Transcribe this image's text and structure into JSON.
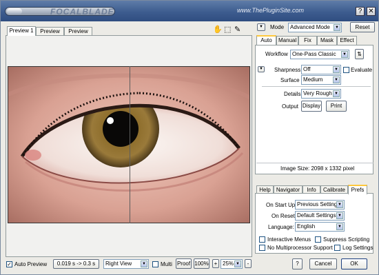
{
  "titlebar": {
    "logo_text": "FOCALBLADE",
    "site": "www.ThePluginSite.com",
    "help_btn": "?",
    "close_btn": "✕"
  },
  "preview_tabs": [
    "Preview 1",
    "Preview 2",
    "Preview 3"
  ],
  "tools": {
    "hand": "✋",
    "marquee": "⬚",
    "picker": "✎"
  },
  "mode": {
    "label": "Mode",
    "value": "Advanced Mode",
    "reset": "Reset",
    "collapse": "▼"
  },
  "main_tabs": [
    "Auto",
    "Manual",
    "Fix",
    "Mask",
    "Effect"
  ],
  "auto": {
    "workflow_label": "Workflow",
    "workflow_value": "One-Pass Classic",
    "workflow_btn": "⇅",
    "sharpness_label": "Sharpness",
    "sharpness_value": "Off",
    "evaluate_label": "Evaluate",
    "surface_label": "Surface",
    "surface_value": "Medium",
    "details_label": "Details",
    "details_value": "Very Rough",
    "output_label": "Output",
    "display_btn": "Display",
    "print_btn": "Print",
    "image_size": "Image Size:  2098 x 1332 pixel"
  },
  "pref_tabs": [
    "Help",
    "Navigator",
    "Info",
    "Calibrate",
    "Prefs"
  ],
  "prefs": {
    "startup_label": "On Start Up",
    "startup_value": "Previous Settings",
    "reset_label": "On Reset",
    "reset_value": "Default Settings",
    "language_label": "Language:",
    "language_value": "English",
    "interactive_menus": "Interactive Menus",
    "suppress_scripting": "Suppress Scripting",
    "no_multiprocessor": "No Multiprocessor Support",
    "log_settings": "Log Settings"
  },
  "bottom": {
    "auto_preview": "Auto Preview",
    "timing": "0.019 s -> 0.3 s",
    "view_value": "Right View",
    "multi": "Multi",
    "proof": "Proof",
    "zoom_100": "100%",
    "plus": "+",
    "zoom_value": "25%",
    "minus": "-",
    "help": "?",
    "cancel": "Cancel",
    "ok": "OK"
  },
  "checks": {
    "auto_preview": true,
    "evaluate": false,
    "multi": false,
    "interactive_menus": false,
    "suppress_scripting": false,
    "no_multiprocessor": false,
    "log_settings": false
  },
  "colors": {
    "title_bar": "#3d5c8f",
    "panel_bg": "#ecebe6",
    "accent_tab": "#ffc83c"
  }
}
